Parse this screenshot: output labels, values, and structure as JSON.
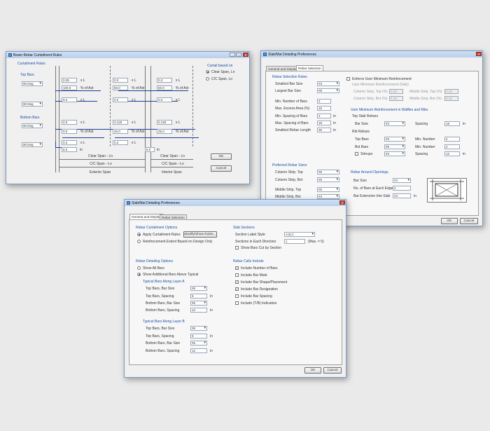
{
  "w1": {
    "title": "Beam Rebar Curtailment Rules",
    "curtail": "Curtailment Rules",
    "top": "Top Bars",
    "bottom": "Bottom Bars",
    "d": "90 Deg",
    "based": "Curtail based on",
    "clear": "Clear Span, Ln",
    "cc": "C/C Span, Lo",
    "r1": [
      "0.25",
      "x L",
      "0.3",
      "x L",
      "0.3",
      "x L"
    ],
    "r2": [
      "100.0",
      "% of Ast",
      "50.0",
      "% of Ast",
      "50.0",
      "% of Ast"
    ],
    "r3": [
      "0.2",
      "x L",
      "0.2",
      "x L",
      "0.2",
      "x L"
    ],
    "r4": [
      "0.0",
      "x L",
      "0.125",
      "x L",
      "0.125",
      "x L"
    ],
    "r5": [
      "0.0",
      "% of Ast",
      "25.0",
      "% of Ast",
      "25.0",
      "% of Ast"
    ],
    "r6": [
      "0.2",
      "x L",
      "0.2",
      "x L"
    ],
    "six": "6.0",
    "in": "in",
    "six2": "6.0",
    "in2": "in",
    "clr1": "Clear Span - Ln",
    "cc1": "C/C Span - Lo",
    "ext": "Exterior Span",
    "clr2": "Clear Span - Ln",
    "cc2": "C/C Span - Lo",
    "int": "Interior Span",
    "ok": "OK",
    "cancel": "Cancel"
  },
  "w2": {
    "title": "Slab/Mat Detailing Preferences",
    "tab1": "General and Display",
    "tab2": "Rebar Selection",
    "rsr": "Rebar Selection Rules",
    "sbs": "Smallest Bar Size",
    "lbs": "Largest Bar Size",
    "sbsv": "#3",
    "lbsv": "#8",
    "mnb": "Min. Number of Bars",
    "mea": "Max. Excess Area (%)",
    "msb": "Min. Spacing of Bars",
    "mxsb": "Max. Spacing of Bars",
    "srl": "Smallest Rebar Length",
    "mnbv": "2",
    "meav": "15",
    "msbv": "2",
    "mxsbv": "18",
    "srlv": "36",
    "in": "in",
    "enf": "Enforce User Minimum Reinforcement",
    "umr": "User Minimum Reinforcement (Slab)",
    "cst": "Column Strip, Top (%)",
    "csb": "Column Strip, Bot (%)",
    "mst": "Middle Strip, Top (%)",
    "msbt": "Middle Strip, Bot (%)",
    "z": "0.18",
    "umrw": "User Minimum Reinforcement in Waffles and Ribs",
    "tsr": "Top Slab Rebars",
    "bs": "Bar Size",
    "bsv": "#3",
    "sp": "Spacing",
    "spv": "18",
    "rib": "Rib Rebars",
    "tb": "Top Bars",
    "bb": "Bot Bars",
    "tbv": "#3",
    "bbv": "#5",
    "mn": "Min. Number",
    "mnv": "2",
    "stir": "Stirrups",
    "stv": "#3",
    "spv2": "12",
    "prs": "Preferred Rebar Sizes",
    "cs1": "Column Strip, Top",
    "cs2": "Column Strip, Bot",
    "ms1": "Middle Strip, Top",
    "ms2": "Middle Strip, Bot",
    "v1": "#6",
    "v2": "#5",
    "v3": "#5",
    "v4": "#4",
    "rao": "Rebar Around Openings",
    "bs2": "Bar Size",
    "bs2v": "#4",
    "nob": "No. of Bars at Each Edge",
    "nobv": "2",
    "bei": "Bar Extension Into Slab",
    "beiv": "24",
    "ok": "OK",
    "cancel": "Cancel"
  },
  "w3": {
    "title": "Slab/Mat Detailing Preferences",
    "tab1": "General and Display",
    "tab2": "Rebar Selection",
    "rco": "Rebar Curtailment Options",
    "acr": "Apply Curtailment Rules",
    "msr": "Modify/Show Rules...",
    "reb": "Reinforcement Extent Based on Design Only",
    "ss": "Slab Sections",
    "sls": "Section Label Style",
    "slsv": "A,B,C",
    "sed": "Sections in Each Direction",
    "sedv": "1",
    "max": "(Max. = 5)",
    "sbc": "Show Bars Cut by Section",
    "rdo": "Rebar Detailing Options",
    "sab": "Show All Bars",
    "saa": "Show Additional Bars Above Typical",
    "tla": "Typical Bars Along Layer A",
    "tbs": "Top Bars, Bar Size",
    "tsp": "Top Bars, Spacing",
    "bbs": "Bottom Bars, Bar Size",
    "bsp": "Bottom Bars, Spacing",
    "a1": "#6",
    "a2": "9",
    "a3": "#5",
    "a4": "12",
    "tlb": "Typical Bars Along Layer B",
    "b1": "#6",
    "b2": "9",
    "b3": "#5",
    "b4": "12",
    "in": "in",
    "rci": "Rebar Calls Include",
    "c1": "Include Number of Bars",
    "c2": "Include Bar Mark",
    "c3": "Include Bar Shape/Placement",
    "c4": "Include Bar Designation",
    "c5": "Include Bar Spacing",
    "c6": "Include (T/B) Indication",
    "ok": "OK",
    "cancel": "Cancel"
  }
}
